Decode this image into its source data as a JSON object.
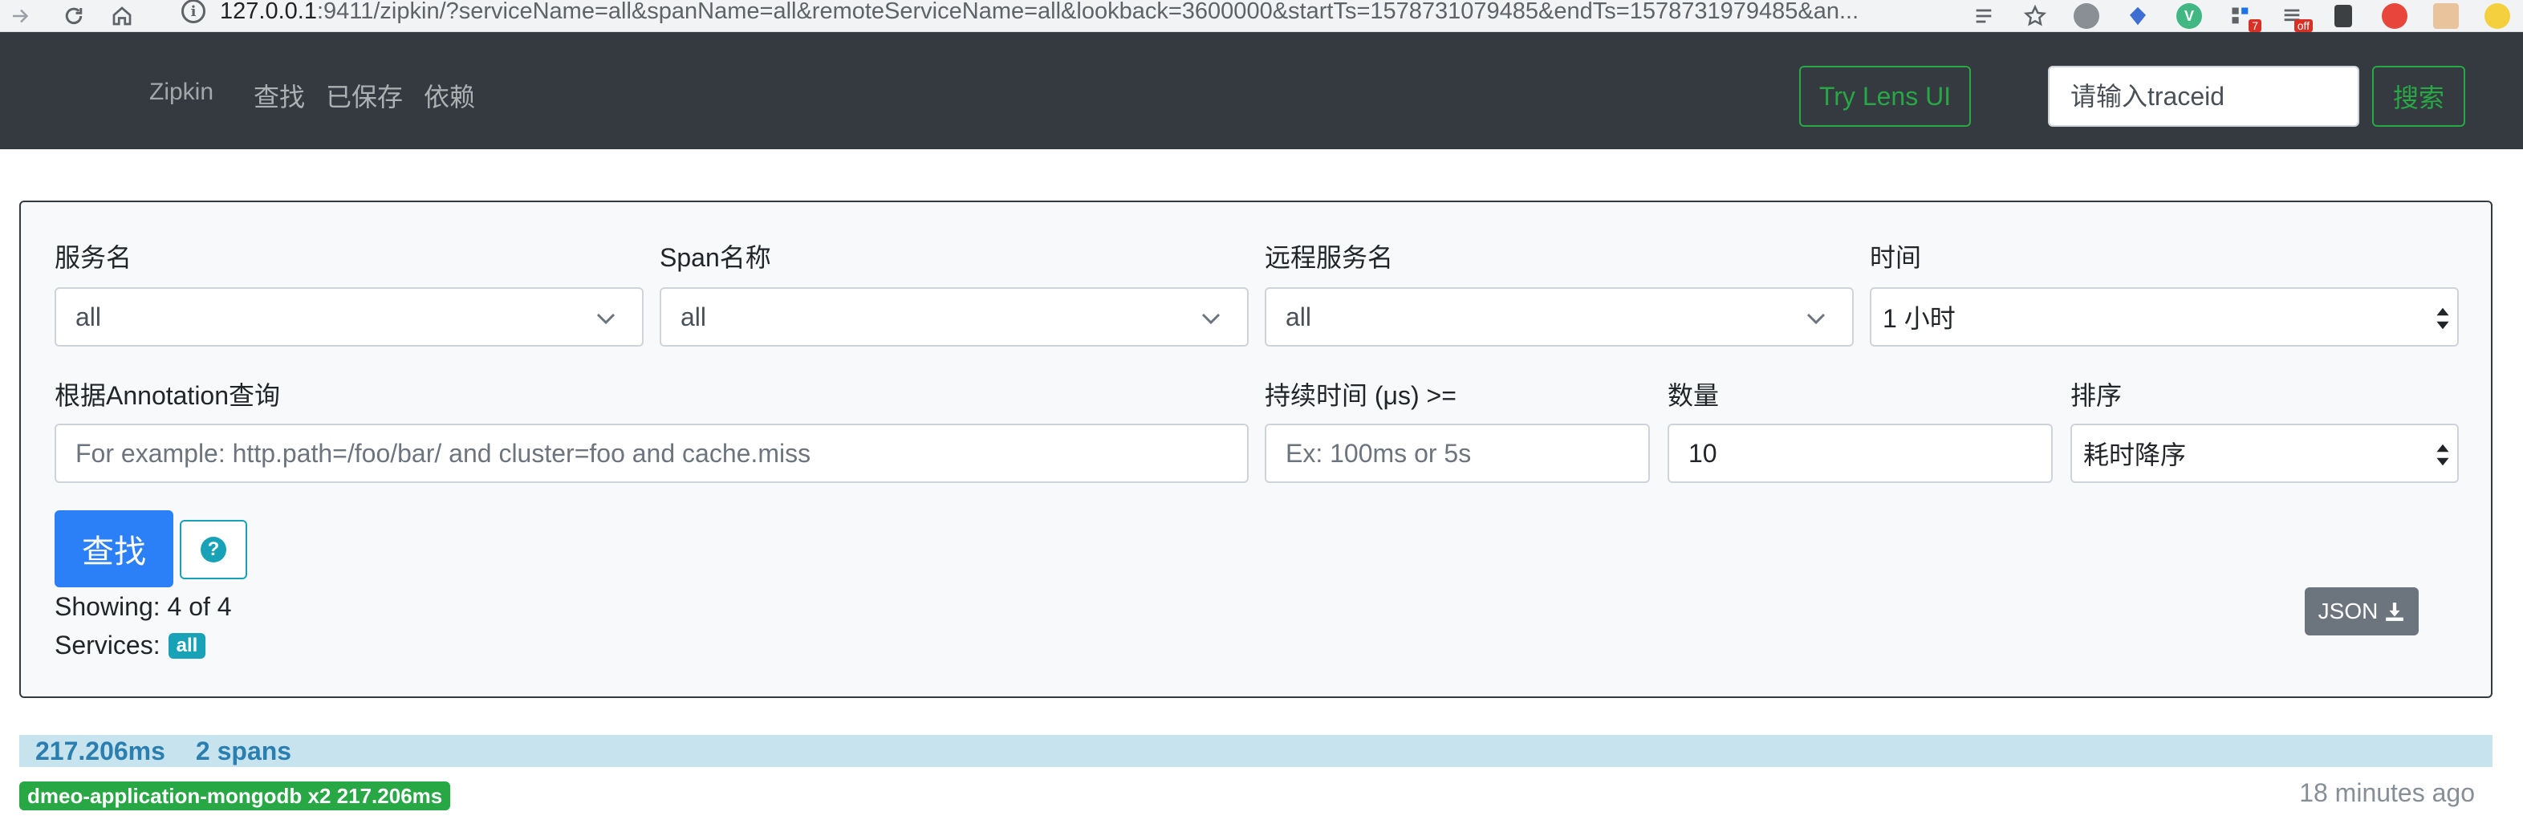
{
  "browser": {
    "url_host": "127.0.0.1",
    "url_rest": ":9411/zipkin/?serviceName=all&spanName=all&remoteServiceName=all&lookback=3600000&startTs=1578731079485&endTs=1578731979485&an...",
    "ext_badge_count": "7",
    "ext_badge_off": "off"
  },
  "navbar": {
    "brand": "Zipkin",
    "links": [
      "查找",
      "已保存",
      "依赖"
    ],
    "lens_button": "Try Lens UI",
    "trace_placeholder": "请输入traceid",
    "search_button": "搜索"
  },
  "form": {
    "service_label": "服务名",
    "service_value": "all",
    "span_label": "Span名称",
    "span_value": "all",
    "remote_label": "远程服务名",
    "remote_value": "all",
    "time_label": "时间",
    "time_value": "1 小时",
    "annotation_label": "根据Annotation查询",
    "annotation_placeholder": "For example: http.path=/foo/bar/ and cluster=foo and cache.miss",
    "duration_label": "持续时间 (μs) >=",
    "duration_placeholder": "Ex: 100ms or 5s",
    "limit_label": "数量",
    "limit_value": "10",
    "sort_label": "排序",
    "sort_value": "耗时降序",
    "find_button": "查找",
    "showing": "Showing: 4 of 4",
    "services_label": "Services:",
    "services_badge": "all",
    "json_button": "JSON"
  },
  "results": [
    {
      "duration": "217.206ms",
      "spans": "2 spans",
      "service_tag": "dmeo-application-mongodb x2 217.206ms",
      "time_ago": "18 minutes ago"
    }
  ],
  "colors": {
    "navbar_bg": "#343a40",
    "accent_green": "#28a745",
    "primary_blue": "#2b7ff7",
    "info_teal": "#17a2b8",
    "result_bar_bg": "#c7e3ee"
  }
}
